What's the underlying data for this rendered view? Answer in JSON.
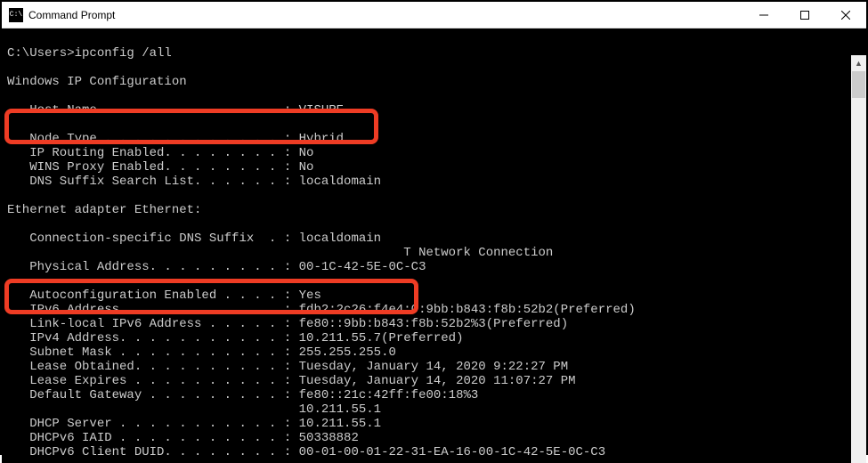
{
  "window": {
    "title": "Command Prompt",
    "icon_label": "C:\\"
  },
  "cmd": {
    "prompt": "C:\\Users>ipconfig /all",
    "section1": "Windows IP Configuration",
    "host_name_line": "   Host Name . . . . . . . . . . . . : VISURE",
    "redacted_line": "",
    "node_type_line": "   Node Type . . . . . . . . . . . . : Hybrid",
    "ip_routing_line": "   IP Routing Enabled. . . . . . . . : No",
    "wins_proxy_line": "   WINS Proxy Enabled. . . . . . . . : No",
    "dns_suffix_line": "   DNS Suffix Search List. . . . . . : localdomain",
    "section2": "Ethernet adapter Ethernet:",
    "conn_dns_line": "   Connection-specific DNS Suffix  . : localdomain",
    "description_line": "                                                     T Network Connection",
    "phys_addr_line": "   Physical Address. . . . . . . . . : 00-1C-42-5E-0C-C3",
    "phys_blank": "",
    "autoconfig_line": "   Autoconfiguration Enabled . . . . : Yes",
    "ipv6_line": "   IPv6 Address. . . . . . . . . . . : fdb2:2c26:f4e4:0:9bb:b843:f8b:52b2(Preferred)",
    "linklocal_line": "   Link-local IPv6 Address . . . . . : fe80::9bb:b843:f8b:52b2%3(Preferred)",
    "ipv4_line": "   IPv4 Address. . . . . . . . . . . : 10.211.55.7(Preferred)",
    "subnet_line": "   Subnet Mask . . . . . . . . . . . : 255.255.255.0",
    "lease_obtained_line": "   Lease Obtained. . . . . . . . . . : Tuesday, January 14, 2020 9:22:27 PM",
    "lease_expires_line": "   Lease Expires . . . . . . . . . . : Tuesday, January 14, 2020 11:07:27 PM",
    "gateway_line": "   Default Gateway . . . . . . . . . : fe80::21c:42ff:fe00:18%3",
    "gateway_line2": "                                       10.211.55.1",
    "dhcp_server_line": "   DHCP Server . . . . . . . . . . . : 10.211.55.1",
    "dhcpv6_iaid_line": "   DHCPv6 IAID . . . . . . . . . . . : 50338882",
    "dhcpv6_duid_line": "   DHCPv6 Client DUID. . . . . . . . : 00-01-00-01-22-31-EA-16-00-1C-42-5E-0C-C3"
  }
}
